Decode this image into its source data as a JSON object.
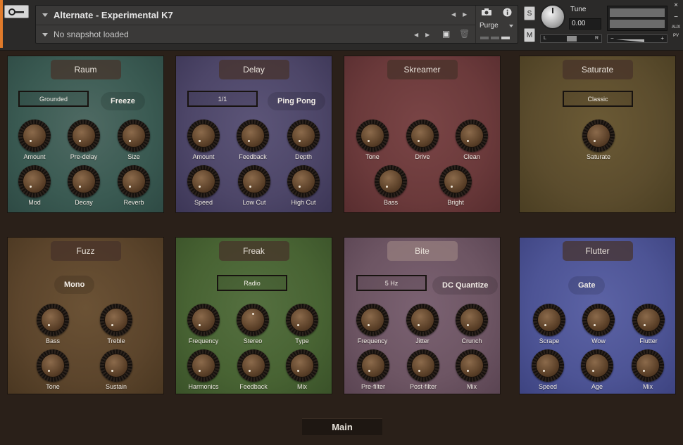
{
  "header": {
    "instrument_name": "Alternate - Experimental K7",
    "snapshot": "No snapshot loaded",
    "purge_label": "Purge",
    "s_label": "S",
    "m_label": "M",
    "tune_label": "Tune",
    "tune_value": "0.00",
    "pan_left": "L",
    "pan_right": "R",
    "vol_minus": "−",
    "vol_plus": "+",
    "aux_label": "AUX",
    "pv_label": "PV",
    "close_label": "×",
    "minimize_label": "−"
  },
  "panels": {
    "raum": {
      "title": "Raum",
      "dropdown": "Grounded",
      "button": "Freeze",
      "knobs": [
        "Amount",
        "Pre-delay",
        "Size",
        "Mod",
        "Decay",
        "Reverb"
      ]
    },
    "delay": {
      "title": "Delay",
      "dropdown": "1/1",
      "button": "Ping Pong",
      "knobs": [
        "Amount",
        "Feedback",
        "Depth",
        "Speed",
        "Low Cut",
        "High Cut"
      ]
    },
    "skreamer": {
      "title": "Skreamer",
      "knobs": [
        "Tone",
        "Drive",
        "Clean",
        "Bass",
        "Bright"
      ]
    },
    "saturate": {
      "title": "Saturate",
      "dropdown": "Classic",
      "knobs": [
        "Saturate"
      ]
    },
    "fuzz": {
      "title": "Fuzz",
      "button": "Mono",
      "knobs": [
        "Bass",
        "Treble",
        "Tone",
        "Sustain"
      ]
    },
    "freak": {
      "title": "Freak",
      "dropdown": "Radio",
      "knobs": [
        "Frequency",
        "Stereo",
        "Type",
        "Harmonics",
        "Feedback",
        "Mix"
      ]
    },
    "bite": {
      "title": "Bite",
      "dropdown": "5 Hz",
      "button": "DC Quantize",
      "knobs": [
        "Frequency",
        "Jitter",
        "Crunch",
        "Pre-filter",
        "Post-filter",
        "Mix"
      ]
    },
    "flutter": {
      "title": "Flutter",
      "button": "Gate",
      "knobs": [
        "Scrape",
        "Wow",
        "Flutter",
        "Speed",
        "Age",
        "Mix"
      ]
    }
  },
  "footer": {
    "tab_label": "Main"
  },
  "colors": {
    "background": "#2a2019",
    "accent": "#e07a2a"
  }
}
